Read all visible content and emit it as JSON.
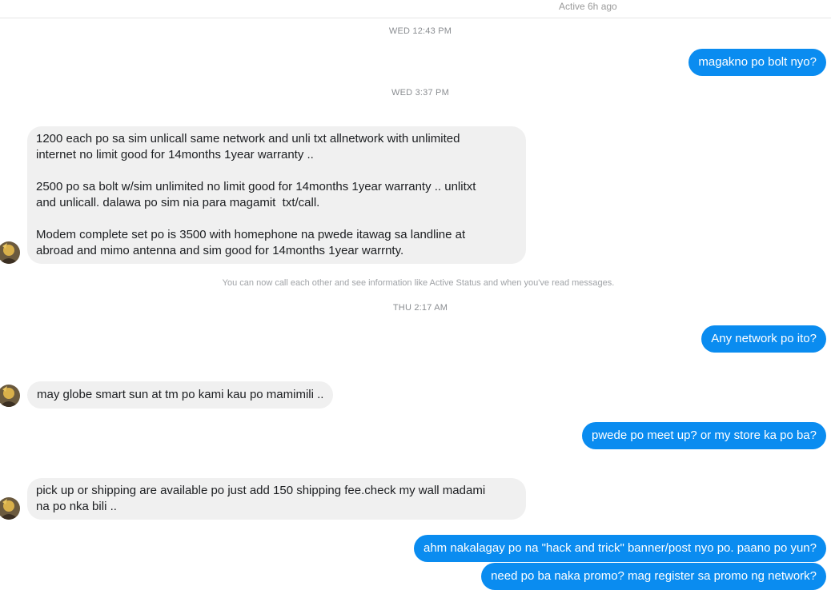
{
  "header": {
    "active_status": "Active 6h ago"
  },
  "timestamps": {
    "t1": "WED 12:43 PM",
    "t2": "WED 3:37 PM",
    "t3": "THU 2:17 AM"
  },
  "system_note": "You can now call each other and see information like Active Status and when you've read messages.",
  "messages": {
    "m1": "magakno po bolt nyo?",
    "m2_p1_l1": "1200 each po sa sim unlicall same network and unli txt allnetwork with unlimited",
    "m2_p1_l2": "internet no limit good for 14months 1year warranty ..",
    "m2_p2_l1": "2500 po sa bolt w/sim unlimited no limit good for 14months 1year warranty .. unlitxt",
    "m2_p2_l2": "and unlicall. dalawa po sim nia para magamit  txt/call.",
    "m2_p3_l1": "Modem complete set po is 3500 with homephone na pwede itawag sa landline at",
    "m2_p3_l2": "abroad and mimo antenna and sim good for 14months 1year warrnty.",
    "m3": "Any network po ito?",
    "m4": "may globe smart sun at tm po kami kau po mamimili ..",
    "m5": "pwede po meet up? or my store ka po ba?",
    "m6_l1": "pick up or shipping are available po just add 150 shipping fee.check my wall madami",
    "m6_l2": "na po nka bili ..",
    "m7": "ahm nakalagay po na \"hack and trick\" banner/post nyo po. paano po yun?",
    "m8": "need po ba naka promo? mag register sa promo ng network?"
  },
  "colors": {
    "outgoing": "#0a8cf0",
    "incoming": "#f0f0f0"
  },
  "icons": {
    "avatar": "contact-avatar"
  }
}
